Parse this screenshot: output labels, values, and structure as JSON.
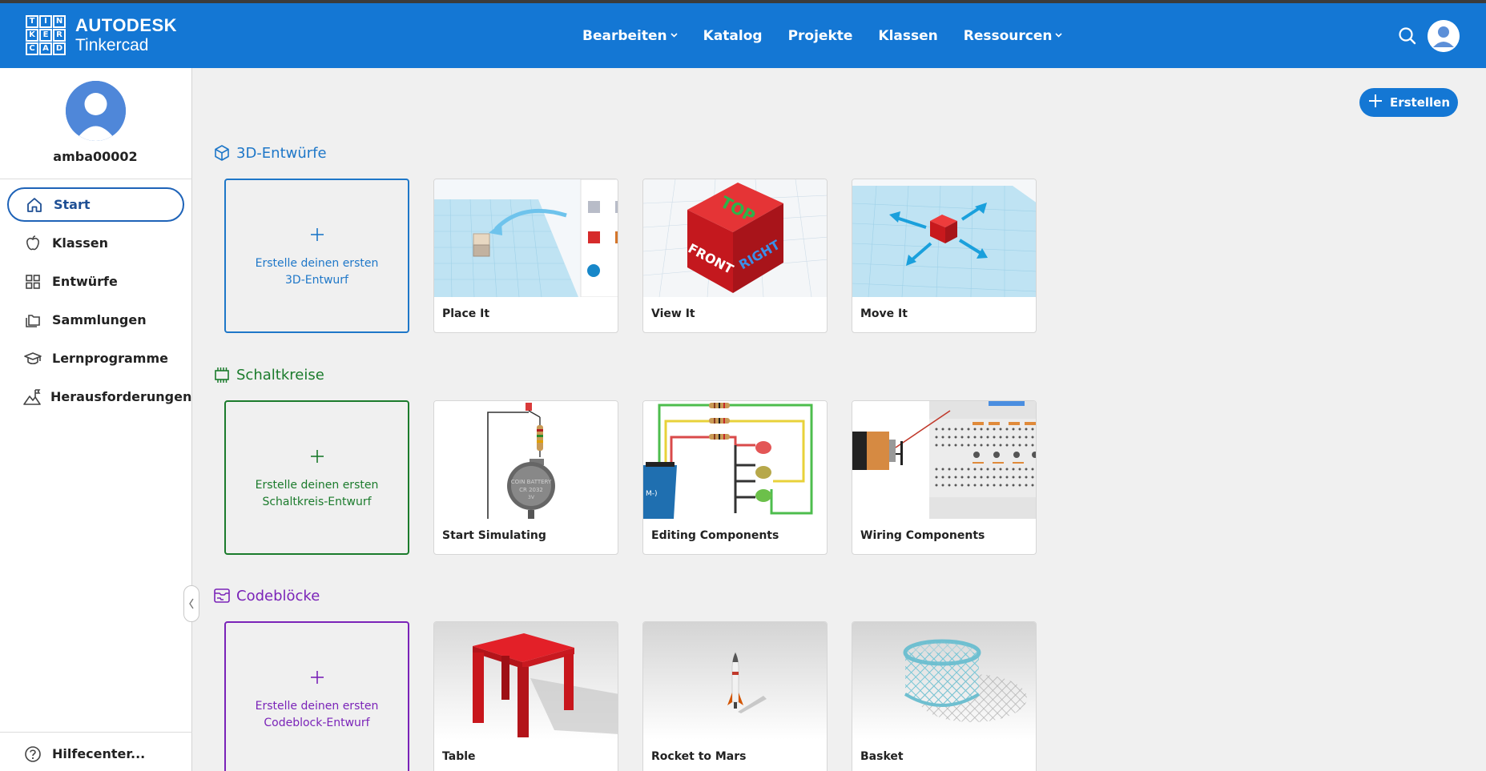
{
  "header": {
    "brand_line1": "AUTODESK",
    "brand_line2": "Tinkercad",
    "logo_letters": [
      "T",
      "I",
      "N",
      "K",
      "E",
      "R",
      "C",
      "A",
      "D"
    ],
    "nav": [
      {
        "label": "Bearbeiten",
        "dropdown": true
      },
      {
        "label": "Katalog",
        "dropdown": false
      },
      {
        "label": "Projekte",
        "dropdown": false
      },
      {
        "label": "Klassen",
        "dropdown": false
      },
      {
        "label": "Ressourcen",
        "dropdown": true
      }
    ],
    "accent": "#1477d4"
  },
  "sidebar": {
    "username": "amba00002",
    "items": [
      {
        "label": "Start",
        "icon": "home-icon",
        "active": true
      },
      {
        "label": "Klassen",
        "icon": "apple-icon"
      },
      {
        "label": "Entwürfe",
        "icon": "grid-icon"
      },
      {
        "label": "Sammlungen",
        "icon": "folder-icon"
      },
      {
        "label": "Lernprogramme",
        "icon": "graduation-cap-icon"
      },
      {
        "label": "Herausforderungen",
        "icon": "mountain-flag-icon"
      }
    ],
    "help": "Hilfecenter..."
  },
  "main": {
    "create_label": "Erstellen",
    "sections": [
      {
        "title": "3D-Entwürfe",
        "color": "#1e77c8",
        "new_label": "Erstelle deinen ersten 3D-Entwurf",
        "cards": [
          "Place It",
          "View It",
          "Move It"
        ]
      },
      {
        "title": "Schaltkreise",
        "color": "#1b7b2c",
        "new_label": "Erstelle deinen ersten Schaltkreis-Entwurf",
        "cards": [
          "Start Simulating",
          "Editing Components",
          "Wiring Components"
        ]
      },
      {
        "title": "Codeblöcke",
        "color": "#7a23b8",
        "new_label": "Erstelle deinen ersten Codeblock-Entwurf",
        "cards": [
          "Table",
          "Rocket to Mars",
          "Basket"
        ]
      }
    ]
  },
  "thumbnail_text": {
    "view_it_top": "TOP",
    "view_it_front": "FRONT",
    "view_it_right": "RIGHT",
    "battery_line1": "COIN BATTERY",
    "battery_line2": "CR 2032",
    "battery_line3": "3V"
  }
}
